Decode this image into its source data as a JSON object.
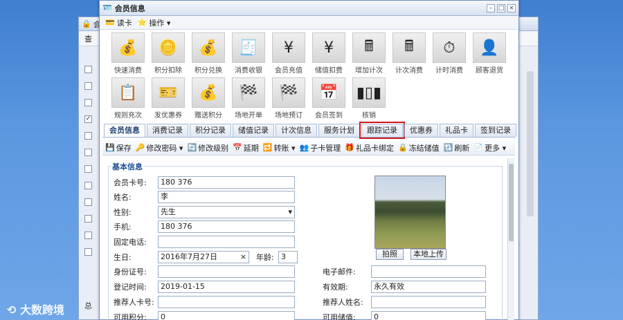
{
  "back_window": {
    "title_prefix": "会",
    "toolbar_snip": "查",
    "bottom_text": "总"
  },
  "window": {
    "title": "会员信息"
  },
  "menu": {
    "read_card": "读卡",
    "operate": "操作 ▾"
  },
  "tiles": [
    {
      "icon": "money-bag-icon",
      "glyph": "💰",
      "label": "快速消费"
    },
    {
      "icon": "coins-minus-icon",
      "glyph": "🪙",
      "label": "积分扣除"
    },
    {
      "icon": "money-bag-exchange-icon",
      "glyph": "💰",
      "label": "积分兑换"
    },
    {
      "icon": "cash-register-icon",
      "glyph": "🧾",
      "label": "消费收银"
    },
    {
      "icon": "yen-add-icon",
      "glyph": "¥",
      "label": "会员充值"
    },
    {
      "icon": "yen-minus-icon",
      "glyph": "¥",
      "label": "储值扣费"
    },
    {
      "icon": "calculator-add-icon",
      "glyph": "🖩",
      "label": "增加计次"
    },
    {
      "icon": "calculator-icon",
      "glyph": "🖩",
      "label": "计次消费"
    },
    {
      "icon": "clock-icon",
      "glyph": "⏱",
      "label": "计时消费"
    },
    {
      "icon": "user-return-icon",
      "glyph": "👤",
      "label": "顾客退货"
    },
    {
      "icon": "rule-recharge-icon",
      "glyph": "📋",
      "label": "规则充次"
    },
    {
      "icon": "coupon-icon",
      "glyph": "🎫",
      "label": "发优惠券"
    },
    {
      "icon": "gift-points-icon",
      "glyph": "💰",
      "label": "赠送积分"
    },
    {
      "icon": "venue-open-icon",
      "glyph": "🏁",
      "label": "场地开单"
    },
    {
      "icon": "venue-book-icon",
      "glyph": "🏁",
      "label": "场地预订"
    },
    {
      "icon": "calendar-checkin-icon",
      "glyph": "📅",
      "label": "会员签到"
    },
    {
      "icon": "barcode-icon",
      "glyph": "▮▯▮",
      "label": "核销"
    }
  ],
  "tabs": [
    "会员信息",
    "消费记录",
    "积分记录",
    "储值记录",
    "计次信息",
    "服务计划",
    "跟踪记录",
    "优惠券",
    "礼品卡",
    "签到记录"
  ],
  "actions": [
    {
      "icon": "save-icon",
      "glyph": "💾",
      "label": "保存"
    },
    {
      "icon": "key-icon",
      "glyph": "🔑",
      "label": "修改密码 ▾"
    },
    {
      "icon": "level-icon",
      "glyph": "🔄",
      "label": "修改级别"
    },
    {
      "icon": "calendar-icon",
      "glyph": "📅",
      "label": "延期"
    },
    {
      "icon": "transfer-icon",
      "glyph": "🔁",
      "label": "转账 ▾"
    },
    {
      "icon": "subcard-icon",
      "glyph": "👥",
      "label": "子卡管理"
    },
    {
      "icon": "giftcard-icon",
      "glyph": "🎁",
      "label": "礼品卡绑定"
    },
    {
      "icon": "freeze-icon",
      "glyph": "🔒",
      "label": "冻结储值"
    },
    {
      "icon": "refresh-icon",
      "glyph": "🔃",
      "label": "刷新"
    },
    {
      "icon": "more-icon",
      "glyph": "📄",
      "label": "更多 ▾"
    }
  ],
  "form": {
    "legend": "基本信息",
    "card_no_label": "会员卡号:",
    "card_no": "180        376",
    "name_label": "姓名:",
    "name": "李",
    "gender_label": "性别:",
    "gender": "先生",
    "phone_label": "手机:",
    "phone": "180        376",
    "tel_label": "固定电话:",
    "tel": "",
    "birthday_label": "生日:",
    "birthday": "2016年7月27日",
    "age_label": "年龄:",
    "age": "3",
    "id_label": "身份证号:",
    "id": "",
    "reg_label": "登记时间:",
    "reg": "2019-01-15",
    "ref_card_label": "推荐人卡号:",
    "ref_card": "",
    "points_label": "可用积分:",
    "points": "0",
    "email_label": "电子邮件:",
    "email": "",
    "valid_label": "有效期:",
    "valid": "永久有效",
    "ref_name_label": "推荐人姓名:",
    "ref_name": "",
    "balance_label": "可用储值:",
    "balance": "0",
    "photo_btn": "拍照",
    "upload_btn": "本地上传"
  },
  "watermark": "大数跨境"
}
